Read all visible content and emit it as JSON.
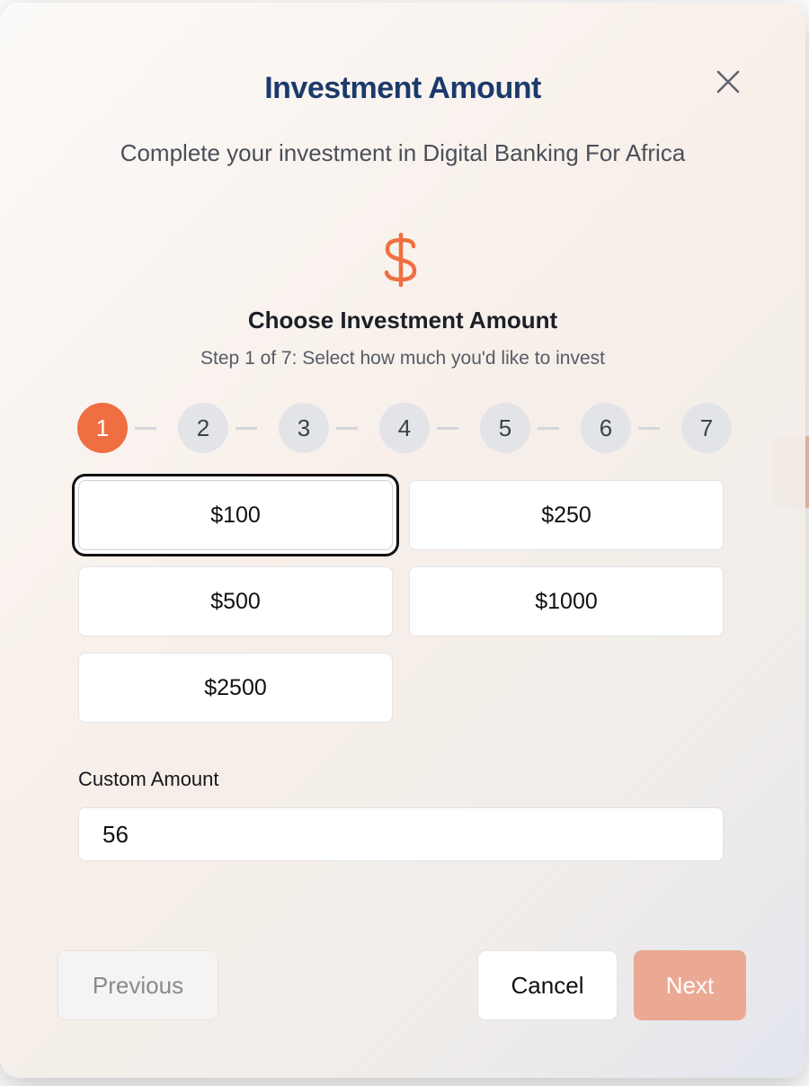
{
  "modal": {
    "title": "Investment Amount",
    "subtitle": "Complete your investment in Digital Banking For Africa",
    "step_heading": "Choose Investment Amount",
    "step_description": "Step 1 of 7: Select how much you'd like to invest"
  },
  "steps": [
    "1",
    "2",
    "3",
    "4",
    "5",
    "6",
    "7"
  ],
  "current_step": 1,
  "amounts": [
    "$100",
    "$250",
    "$500",
    "$1000",
    "$2500"
  ],
  "selected_amount": "$100",
  "custom_amount": {
    "label": "Custom Amount",
    "value": "56"
  },
  "buttons": {
    "previous": "Previous",
    "cancel": "Cancel",
    "next": "Next"
  },
  "icons": {
    "close": "close-icon",
    "currency": "dollar-icon"
  },
  "colors": {
    "accent": "#ef6f42",
    "title": "#1b3a6b",
    "next_disabled": "#eba994"
  }
}
